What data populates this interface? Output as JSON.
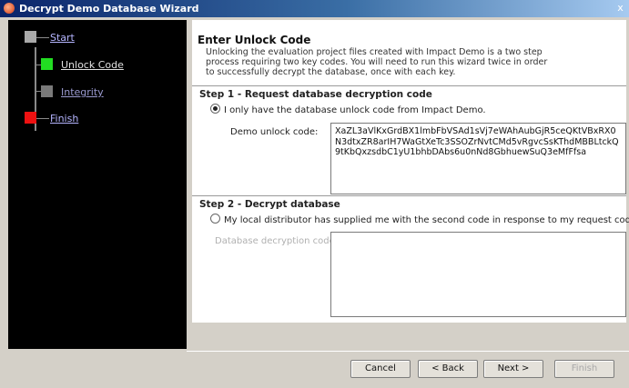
{
  "window": {
    "title": "Decrypt Demo Database Wizard",
    "close_glyph": "x"
  },
  "nav": {
    "steps": [
      {
        "label": "Start",
        "color": "#a9a9a9",
        "text_color": "#b5b5ff",
        "state": "done"
      },
      {
        "label": "Unlock Code",
        "color": "#22dd22",
        "text_color": "#e0e0e0",
        "state": "current"
      },
      {
        "label": "Integrity",
        "color": "#7a7a7a",
        "text_color": "#9a9ad0",
        "state": "pending"
      },
      {
        "label": "Finish",
        "color": "#ee1111",
        "text_color": "#b5b5ff",
        "state": "pending"
      }
    ]
  },
  "header": {
    "title": "Enter Unlock Code",
    "description": "Unlocking the evaluation project files created with Impact Demo is a two step process requiring two key codes. You will need to run this wizard twice in order to successfully decrypt the database, once with each key."
  },
  "step1": {
    "title": "Step 1 - Request database decryption code",
    "radio_label": "I only have the database unlock code from Impact Demo.",
    "radio_checked": true,
    "field_label": "Demo unlock code:",
    "code_value": "XaZL3aVlKxGrdBX1lmbFbVSAd1sVj7eWAhAubGjR5ceQKtVBxRX0N3dtxZR8arIH7WaGtXeTc3SSOZrNvtCMd5vRgvcSsKThdMBBLtckQ9tKbQxzsdbC1yU1bhbDAbs6u0nNd8GbhuewSuQ3eMfFfsa"
  },
  "step2": {
    "title": "Step 2 - Decrypt database",
    "radio_label": "My local distributor has supplied me with the second code in response to my request code.",
    "radio_checked": false,
    "field_label": "Database decryption code:",
    "code_value": ""
  },
  "buttons": {
    "cancel": "Cancel",
    "back": "< Back",
    "next": "Next >",
    "finish": "Finish"
  }
}
